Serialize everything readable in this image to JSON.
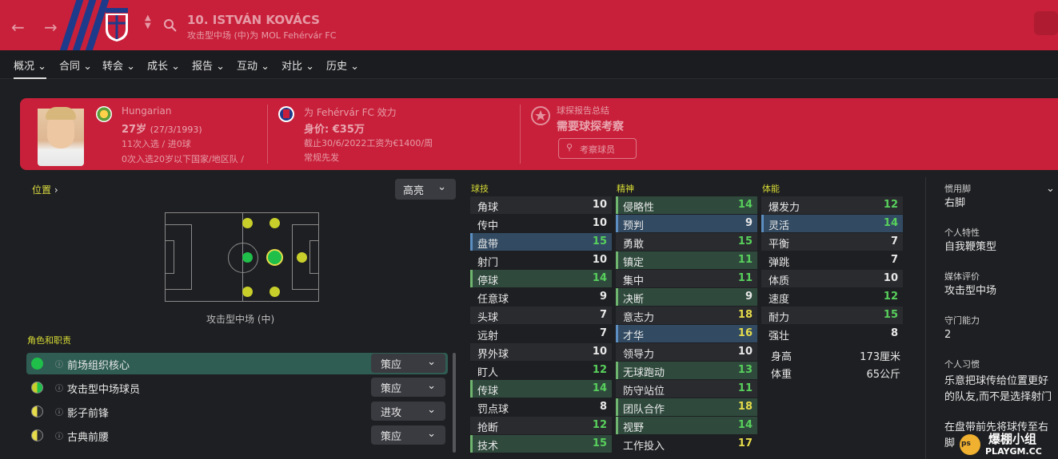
{
  "header": {
    "back_icon": "arrow-left-icon",
    "forward_icon": "arrow-right-icon",
    "search_icon": "search-icon",
    "name": "10. ISTVÁN KOVÁCS",
    "subtitle": "攻击型中场 (中)为 MOL Fehérvár FC",
    "colors": {
      "primary": "#c8203a",
      "secondary": "#1e3a8a"
    }
  },
  "tabs": [
    {
      "label": "概况"
    },
    {
      "label": "合同"
    },
    {
      "label": "转会"
    },
    {
      "label": "成长"
    },
    {
      "label": "报告"
    },
    {
      "label": "互动"
    },
    {
      "label": "对比"
    },
    {
      "label": "历史"
    }
  ],
  "card": {
    "nationality": "Hungarian",
    "age": "27岁",
    "dob": "(27/3/1993)",
    "caps": "11次入选 / 进0球",
    "youth_caps": "0次入选20岁以下国家/地区队 /",
    "club": "为 Fehérvár FC 效力",
    "value": "身价: €35万",
    "contract": "截止30/6/2022工资为€1400/周",
    "role_status": "常规先发",
    "scout_title": "球探报告总结",
    "scout_text": "需要球探考察",
    "scout_button": "考察球员"
  },
  "position": {
    "header": "位置",
    "highlight": "高亮",
    "label": "攻击型中场 (中)"
  },
  "roles": {
    "header": "角色和职责",
    "items": [
      {
        "name": "前场组织核心",
        "duty": "策应"
      },
      {
        "name": "攻击型中场球员",
        "duty": "策应"
      },
      {
        "name": "影子前锋",
        "duty": "进攻"
      },
      {
        "name": "古典前腰",
        "duty": "策应"
      }
    ]
  },
  "technical": {
    "header": "球技",
    "items": [
      {
        "name": "角球",
        "value": "10"
      },
      {
        "name": "传中",
        "value": "10"
      },
      {
        "name": "盘带",
        "value": "15"
      },
      {
        "name": "射门",
        "value": "10"
      },
      {
        "name": "停球",
        "value": "14"
      },
      {
        "name": "任意球",
        "value": "9"
      },
      {
        "name": "头球",
        "value": "7"
      },
      {
        "name": "远射",
        "value": "7"
      },
      {
        "name": "界外球",
        "value": "10"
      },
      {
        "name": "盯人",
        "value": "12"
      },
      {
        "name": "传球",
        "value": "14"
      },
      {
        "name": "罚点球",
        "value": "8"
      },
      {
        "name": "抢断",
        "value": "12"
      },
      {
        "name": "技术",
        "value": "15"
      }
    ]
  },
  "mental": {
    "header": "精神",
    "items": [
      {
        "name": "侵略性",
        "value": "14"
      },
      {
        "name": "预判",
        "value": "9"
      },
      {
        "name": "勇敢",
        "value": "15"
      },
      {
        "name": "镇定",
        "value": "11"
      },
      {
        "name": "集中",
        "value": "11"
      },
      {
        "name": "决断",
        "value": "9"
      },
      {
        "name": "意志力",
        "value": "18"
      },
      {
        "name": "才华",
        "value": "16"
      },
      {
        "name": "领导力",
        "value": "10"
      },
      {
        "name": "无球跑动",
        "value": "13"
      },
      {
        "name": "防守站位",
        "value": "11"
      },
      {
        "name": "团队合作",
        "value": "18"
      },
      {
        "name": "视野",
        "value": "14"
      },
      {
        "name": "工作投入",
        "value": "17"
      }
    ]
  },
  "physical": {
    "header": "体能",
    "items": [
      {
        "name": "爆发力",
        "value": "12"
      },
      {
        "name": "灵活",
        "value": "14"
      },
      {
        "name": "平衡",
        "value": "7"
      },
      {
        "name": "弹跳",
        "value": "7"
      },
      {
        "name": "体质",
        "value": "10"
      },
      {
        "name": "速度",
        "value": "12"
      },
      {
        "name": "耐力",
        "value": "15"
      },
      {
        "name": "强壮",
        "value": "8"
      }
    ],
    "height_label": "身高",
    "height_value": "173厘米",
    "weight_label": "体重",
    "weight_value": "65公斤"
  },
  "right_panel": {
    "foot_label": "惯用脚",
    "foot_value": "右脚",
    "trait_label": "个人特性",
    "trait_value": "自我鞭策型",
    "media_label": "媒体评价",
    "media_value": "攻击型中场",
    "gk_label": "守门能力",
    "gk_value": "2",
    "habit_label": "个人习惯",
    "habit_1": "乐意把球传给位置更好的队友,而不是选择射门",
    "habit_2": "在盘带前先将球传至右脚"
  },
  "watermark": {
    "brand": "爆棚小组",
    "site": "PLAYGM.CC"
  }
}
